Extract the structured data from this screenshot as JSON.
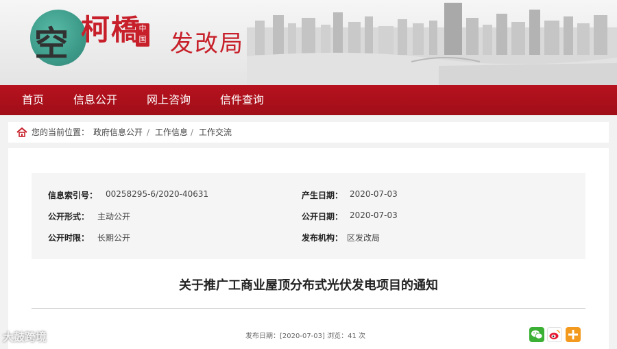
{
  "banner": {
    "logo_char": "空",
    "logo_script": "柯橋",
    "logo_seal": "中国",
    "dept_title": "发改局"
  },
  "nav": {
    "items": [
      "首页",
      "信息公开",
      "网上咨询",
      "信件查询"
    ]
  },
  "breadcrumb": {
    "prefix": "您的当前位置：",
    "items": [
      "政府信息公开",
      "工作信息",
      "工作交流"
    ],
    "separator": "/"
  },
  "meta": {
    "index_label": "信息索引号：",
    "index_value": "00258295-6/2020-40631",
    "created_label": "产生日期：",
    "created_value": "2020-07-03",
    "form_label": "公开形式：",
    "form_value": "主动公开",
    "pubdate_label": "公开日期：",
    "pubdate_value": "2020-07-03",
    "period_label": "公开时限：",
    "period_value": "长期公开",
    "agency_label": "发布机构：",
    "agency_value": "区发改局"
  },
  "article": {
    "title": "关于推广工商业屋顶分布式光伏发电项目的通知",
    "pubinfo": "发布日期：[2020-07-03] 浏览：41 次"
  },
  "share": {
    "wechat_icon": "wechat-icon",
    "weibo_icon": "weibo-icon",
    "more_icon": "plus-icon",
    "colors": {
      "wechat": "#3cb034",
      "weibo": "#e6162d",
      "more": "#f39a1e"
    }
  },
  "watermark": {
    "text": "大鼓跨境"
  },
  "colors": {
    "brand_red": "#b6121e",
    "title_red": "#c7202a"
  }
}
